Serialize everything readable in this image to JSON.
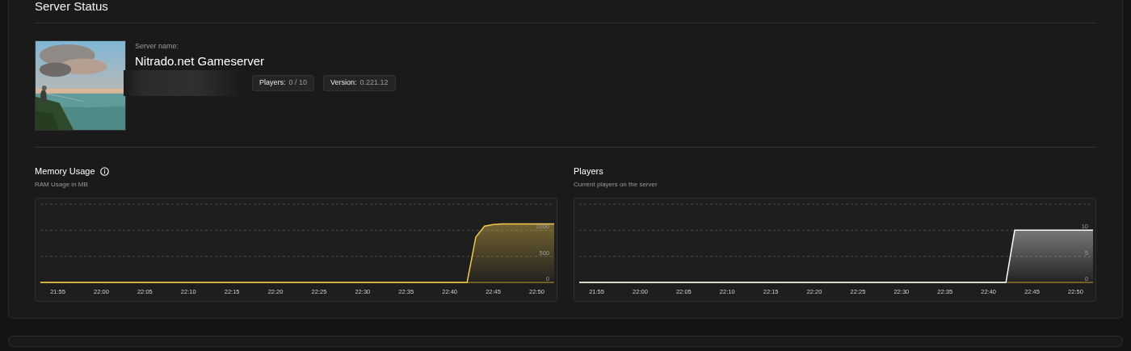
{
  "title": "Server Status",
  "server": {
    "label": "Server name:",
    "name": "Nitrado.net Gameserver",
    "badges": [
      {
        "label": "Players:",
        "value": "0 / 10"
      },
      {
        "label": "Version:",
        "value": "0.221.12"
      }
    ]
  },
  "charts": [
    {
      "title": "Memory Usage",
      "info": true,
      "subtitle": "RAM Usage in MB",
      "chart_data": {
        "type": "area",
        "categories": [
          null,
          null,
          "21:55",
          null,
          null,
          null,
          null,
          "22:00",
          null,
          null,
          null,
          null,
          "22:05",
          null,
          null,
          null,
          null,
          "22:10",
          null,
          null,
          null,
          null,
          "22:15",
          null,
          null,
          null,
          null,
          "22:20",
          null,
          null,
          null,
          null,
          "22:25",
          null,
          null,
          null,
          null,
          "22:30",
          null,
          null,
          null,
          null,
          "22:35",
          null,
          null,
          null,
          null,
          "22:40",
          null,
          null,
          null,
          null,
          "22:45",
          null,
          null,
          null,
          null,
          "22:50",
          null,
          null
        ],
        "series": [
          {
            "color": "#f2c94c",
            "values": [
              0,
              0,
              0,
              0,
              0,
              0,
              0,
              0,
              0,
              0,
              0,
              0,
              0,
              0,
              0,
              0,
              0,
              0,
              0,
              0,
              0,
              0,
              0,
              0,
              0,
              0,
              0,
              0,
              0,
              0,
              0,
              0,
              0,
              0,
              0,
              0,
              0,
              0,
              0,
              0,
              0,
              0,
              0,
              0,
              0,
              0,
              0,
              0,
              0,
              0,
              870,
              1080,
              1110,
              1120,
              1120,
              1120,
              1120,
              1120,
              1120,
              1120
            ]
          }
        ],
        "ylim": [
          0,
          1500
        ],
        "yticks": [
          0,
          500,
          1000
        ]
      }
    },
    {
      "title": "Players",
      "info": false,
      "subtitle": "Current players on the server",
      "chart_data": {
        "type": "area",
        "categories": [
          null,
          null,
          "21:55",
          null,
          null,
          null,
          null,
          "22:00",
          null,
          null,
          null,
          null,
          "22:05",
          null,
          null,
          null,
          null,
          "22:10",
          null,
          null,
          null,
          null,
          "22:15",
          null,
          null,
          null,
          null,
          "22:20",
          null,
          null,
          null,
          null,
          "22:25",
          null,
          null,
          null,
          null,
          "22:30",
          null,
          null,
          null,
          null,
          "22:35",
          null,
          null,
          null,
          null,
          "22:40",
          null,
          null,
          null,
          null,
          "22:45",
          null,
          null,
          null,
          null,
          "22:50",
          null,
          null
        ],
        "series": [
          {
            "color": "#ffffff",
            "values": [
              0,
              0,
              0,
              0,
              0,
              0,
              0,
              0,
              0,
              0,
              0,
              0,
              0,
              0,
              0,
              0,
              0,
              0,
              0,
              0,
              0,
              0,
              0,
              0,
              0,
              0,
              0,
              0,
              0,
              0,
              0,
              0,
              0,
              0,
              0,
              0,
              0,
              0,
              0,
              0,
              0,
              0,
              0,
              0,
              0,
              0,
              0,
              0,
              0,
              0,
              10,
              10,
              10,
              10,
              10,
              10,
              10,
              10,
              10,
              10
            ]
          }
        ],
        "ylim": [
          0,
          15
        ],
        "yticks": [
          0,
          5,
          10
        ]
      }
    }
  ]
}
